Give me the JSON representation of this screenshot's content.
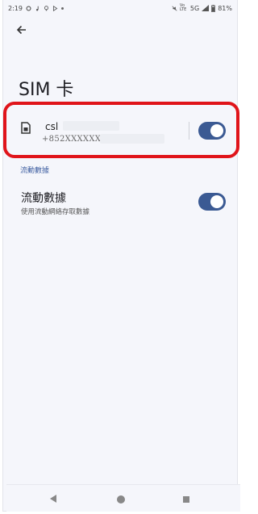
{
  "status_bar": {
    "time": "2:19",
    "network": "5G",
    "volte": "Vo LTE",
    "battery": "81%",
    "left_icons": [
      "settings-icon",
      "music-note-icon",
      "bulb-icon",
      "play-store-icon"
    ],
    "right_icons": [
      "mute-icon",
      "signal-icon",
      "battery-icon"
    ]
  },
  "header": {
    "title": "SIM 卡",
    "back_icon": "arrow-left-icon"
  },
  "sim": {
    "carrier": "csl",
    "number": "+852XXXXXXXX",
    "enabled": true,
    "icon": "sim-card-icon"
  },
  "section": {
    "header": "流動數據"
  },
  "mobile_data": {
    "title": "流動數據",
    "subtitle": "使用流動網絡存取數據",
    "enabled": true
  },
  "nav_bar": {
    "icons": [
      "back-triangle-icon",
      "home-circle-icon",
      "recents-square-icon"
    ]
  },
  "colors": {
    "accent": "#3b5a93",
    "highlight": "#e0141a",
    "section_header": "#3f5fa1",
    "background": "#f5f6fb"
  }
}
